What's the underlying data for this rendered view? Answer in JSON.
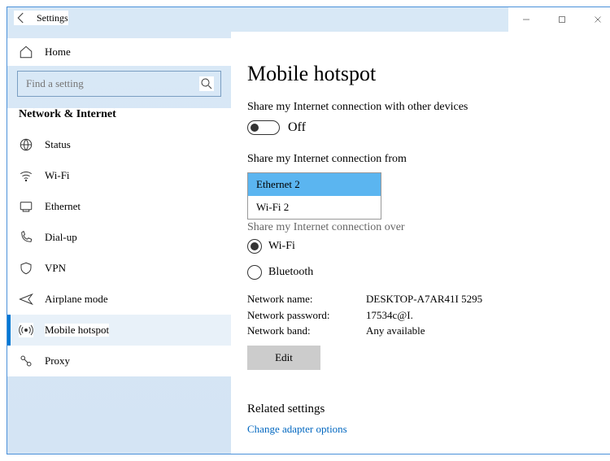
{
  "window": {
    "title": "Settings"
  },
  "sidebar": {
    "home": "Home",
    "search_placeholder": "Find a setting",
    "section": "Network & Internet",
    "items": [
      {
        "label": "Status"
      },
      {
        "label": "Wi-Fi"
      },
      {
        "label": "Ethernet"
      },
      {
        "label": "Dial-up"
      },
      {
        "label": "VPN"
      },
      {
        "label": "Airplane mode"
      },
      {
        "label": "Mobile hotspot"
      },
      {
        "label": "Proxy"
      }
    ]
  },
  "page": {
    "title": "Mobile hotspot",
    "share_label": "Share my Internet connection with other devices",
    "toggle_state": "Off",
    "share_from_label": "Share my Internet connection from",
    "dd_options": [
      "Ethernet 2",
      "Wi-Fi 2"
    ],
    "share_over_label": "Share my Internet connection over",
    "radio_wifi": "Wi-Fi",
    "radio_bt": "Bluetooth",
    "net_name_k": "Network name:",
    "net_name_v": "DESKTOP-A7AR41I 5295",
    "net_pass_k": "Network password:",
    "net_pass_v": "17534c@I.",
    "net_band_k": "Network band:",
    "net_band_v": "Any available",
    "edit": "Edit",
    "related_heading": "Related settings",
    "related_link": "Change adapter options"
  }
}
